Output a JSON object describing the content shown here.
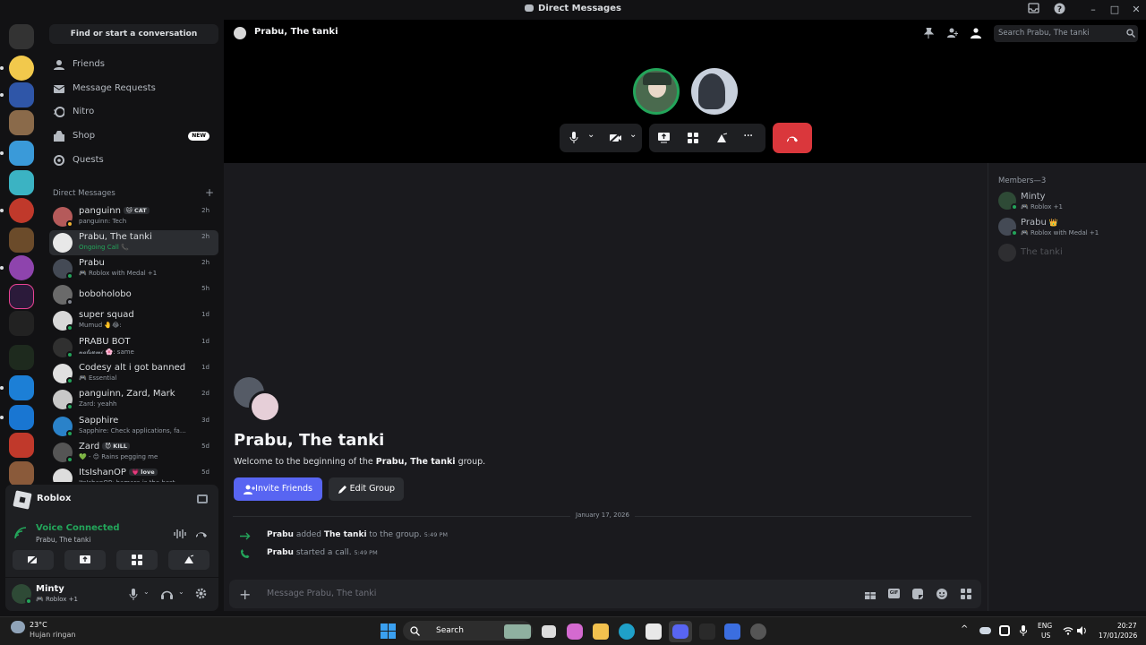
{
  "window": {
    "title": "Direct Messages"
  },
  "sidebar": {
    "find_label": "Find or start a conversation",
    "nav": [
      {
        "label": "Friends",
        "icon": "friends-icon"
      },
      {
        "label": "Message Requests",
        "icon": "mail-icon"
      },
      {
        "label": "Nitro",
        "icon": "nitro-icon"
      },
      {
        "label": "Shop",
        "icon": "shop-icon",
        "badge": "NEW"
      },
      {
        "label": "Quests",
        "icon": "quests-icon"
      }
    ],
    "dm_header": "Direct Messages",
    "dm_add": "+",
    "dms": [
      {
        "name": "panguinn",
        "tag": "🐱 CAT",
        "sub": "panguinn: Tech",
        "time": "2h",
        "status": "idle",
        "color": "#b55a5a"
      },
      {
        "name": "Prabu, The tanki",
        "sub": "Ongoing Call 📞",
        "time": "2h",
        "status": "",
        "color": "#e8e8e8",
        "active": true
      },
      {
        "name": "Prabu",
        "sub": "🎮 Roblox with Medal +1",
        "time": "2h",
        "status": "online",
        "color": "#444a55"
      },
      {
        "name": "boboholobo",
        "sub": "",
        "time": "5h",
        "status": "offline",
        "color": "#6a6a6a"
      },
      {
        "name": "super squad",
        "sub": "Mumud 🤚😂:",
        "time": "1d",
        "status": "online",
        "color": "#d8d8d8"
      },
      {
        "name": "PRABU BOT",
        "sub": "𝓷𝓪𝓽𝓼𝓾𝓶𝓲 🌸: same",
        "time": "1d",
        "status": "online",
        "color": "#303030"
      },
      {
        "name": "Codesy alt i got banned",
        "sub": "🎮 Essential",
        "time": "1d",
        "status": "online",
        "color": "#e0e0e0"
      },
      {
        "name": "panguinn, Zard, Mark",
        "sub": "Zard: yeahh",
        "time": "2d",
        "status": "online",
        "color": "#c8c8c8"
      },
      {
        "name": "Sapphire",
        "sub": "Sapphire: Check applications, faq, ...",
        "time": "3d",
        "status": "online",
        "color": "#2a82c9"
      },
      {
        "name": "Zard",
        "tag": "😈 KILL",
        "sub": "💚 - 😊 Rains pegging me",
        "time": "5d",
        "status": "online",
        "color": "#555"
      },
      {
        "name": "ItsIshanOP",
        "tag": "💗 love",
        "sub": "ItsIshanOP: hamara is the best",
        "time": "5d",
        "status": "online",
        "color": "#ddd"
      }
    ],
    "activity": {
      "label": "Roblox"
    },
    "voice": {
      "status": "Voice Connected",
      "channel": "Prabu, The tanki"
    },
    "user": {
      "name": "Minty",
      "sub": "🎮 Roblox +1"
    }
  },
  "header": {
    "channel": "Prabu, The tanki",
    "search_placeholder": "Search Prabu, The tanki"
  },
  "chat": {
    "title": "Prabu, The tanki",
    "welcome_pre": "Welcome to the beginning of the ",
    "welcome_name": "Prabu, The tanki",
    "welcome_post": " group.",
    "invite_label": "Invite Friends",
    "edit_label": "Edit Group",
    "date_divider": "January 17, 2026",
    "events": [
      {
        "actor": "Prabu",
        "mid": " added ",
        "target": "The tanki",
        "post": " to the group.",
        "time": "5:49 PM",
        "icon": "arrow-right-icon"
      },
      {
        "actor": "Prabu",
        "mid": " started a call.",
        "target": "",
        "post": "",
        "time": "5:49 PM",
        "icon": "phone-icon"
      }
    ],
    "message_placeholder": "Message Prabu, The tanki"
  },
  "members": {
    "header": "Members—3",
    "list": [
      {
        "name": "Minty",
        "sub": "🎮 Roblox +1",
        "crown": "",
        "color": "#2e4a36",
        "online": true
      },
      {
        "name": "Prabu",
        "sub": "🎮 Roblox with Medal +1",
        "crown": "👑",
        "color": "#444a55",
        "online": true
      },
      {
        "name": "The tanki",
        "sub": "",
        "crown": "",
        "color": "#555",
        "online": false
      }
    ]
  },
  "taskbar": {
    "weather_temp": "23°C",
    "weather_desc": "Hujan ringan",
    "search_label": "Search",
    "lang_top": "ENG",
    "lang_bottom": "US",
    "time": "20:27",
    "date": "17/01/2026"
  },
  "colors": {
    "accent": "#5865f2",
    "danger": "#da373c",
    "online": "#23a55a",
    "idle": "#f0b232"
  }
}
